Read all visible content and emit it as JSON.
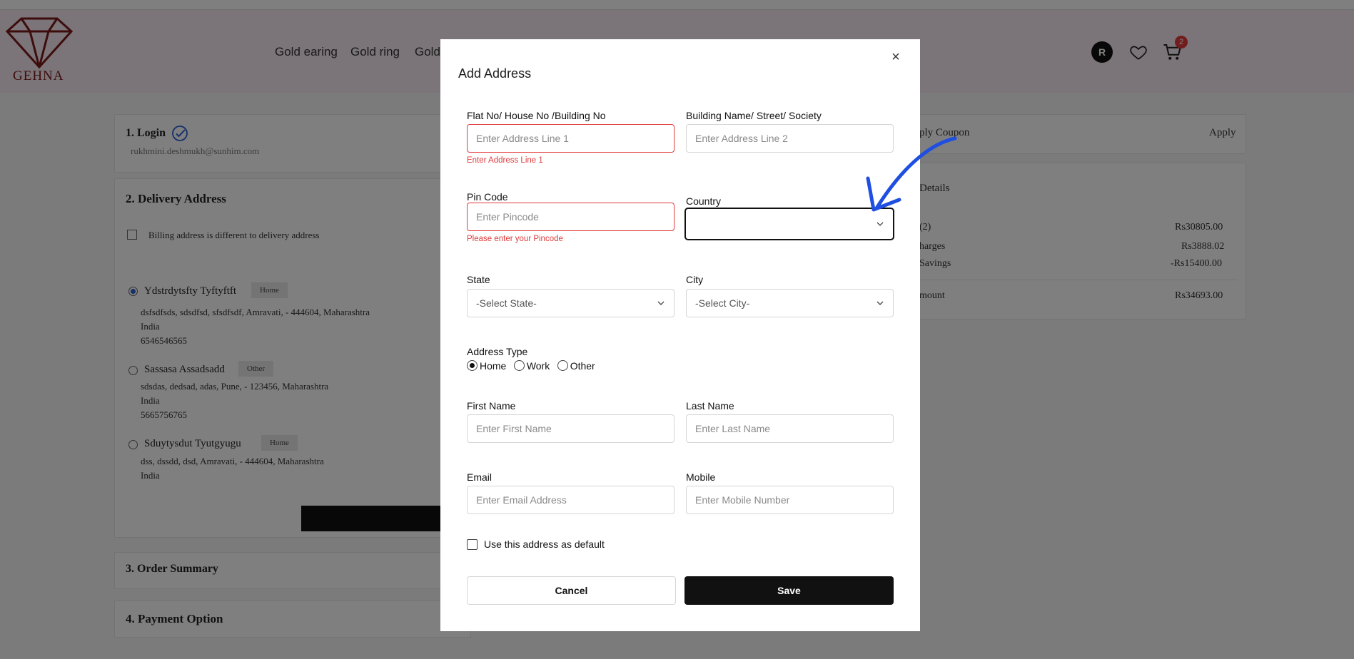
{
  "header": {
    "logo_text": "GEHNA",
    "nav": [
      "Gold earing",
      "Gold ring",
      "Gold"
    ],
    "avatar_initial": "R",
    "cart_count": "2"
  },
  "checkout": {
    "login": {
      "title": "1. Login",
      "email": "rukhmini.deshmukh@sunhim.com"
    },
    "delivery": {
      "title": "2. Delivery Address",
      "billing_label": "Billing address is different to delivery address",
      "addresses": [
        {
          "name": "Ydstrdytsfty Tyftyftft",
          "tag": "Home",
          "line1": "dsfsdfsds, sdsdfsd, sfsdfsdf, Amravati, - 444604, Maharashtra",
          "country": "India",
          "phone": "6546546565",
          "selected": true
        },
        {
          "name": "Sassasa Assadsadd",
          "tag": "Other",
          "line1": "sdsdas, dedsad, adas, Pune, - 123456, Maharashtra",
          "country": "India",
          "phone": "5665756765",
          "selected": false
        },
        {
          "name": "Sduytysdut Tyutgyugu",
          "tag": "Home",
          "line1": "dss, dssdd, dsd, Amravati, - 444604, Maharashtra",
          "country": "India",
          "phone": "",
          "selected": false
        }
      ]
    },
    "order_summary_title": "3. Order Summary",
    "payment_title": "4. Payment Option"
  },
  "sidebar": {
    "coupon_label": "ply Coupon",
    "apply_label": "Apply",
    "details_label": "Details",
    "rows": [
      {
        "label": "(2)",
        "value": "Rs30805.00"
      },
      {
        "label": "harges",
        "value": "Rs3888.02"
      },
      {
        "label": "Savings",
        "value": "-Rs15400.00"
      }
    ],
    "total_label": "mount",
    "total_value": "Rs34693.00"
  },
  "modal": {
    "title": "Add Address",
    "close_glyph": "×",
    "address1": {
      "label": "Flat No/ House No /Building No",
      "placeholder": "Enter Address Line 1",
      "error": "Enter Address Line 1"
    },
    "address2": {
      "label": "Building Name/ Street/ Society",
      "placeholder": "Enter Address Line 2"
    },
    "pincode": {
      "label": "Pin Code",
      "placeholder": "Enter Pincode",
      "error": "Please enter your Pincode"
    },
    "country": {
      "label": "Country",
      "value": ""
    },
    "state": {
      "label": "State",
      "value": "-Select State-"
    },
    "city": {
      "label": "City",
      "value": "-Select City-"
    },
    "address_type": {
      "label": "Address Type",
      "options": [
        "Home",
        "Work",
        "Other"
      ],
      "selected": "Home"
    },
    "first_name": {
      "label": "First Name",
      "placeholder": "Enter First Name"
    },
    "last_name": {
      "label": "Last Name",
      "placeholder": "Enter Last Name"
    },
    "email": {
      "label": "Email",
      "placeholder": "Enter Email Address"
    },
    "mobile": {
      "label": "Mobile",
      "placeholder": "Enter Mobile Number"
    },
    "default_label": "Use this address as default",
    "cancel_label": "Cancel",
    "save_label": "Save"
  },
  "annotation": {
    "arrow_color": "#1f4fe0"
  },
  "colors": {
    "error": "#e03b3b",
    "primary_button": "#111111",
    "header_bg": "#f6e9f1"
  }
}
